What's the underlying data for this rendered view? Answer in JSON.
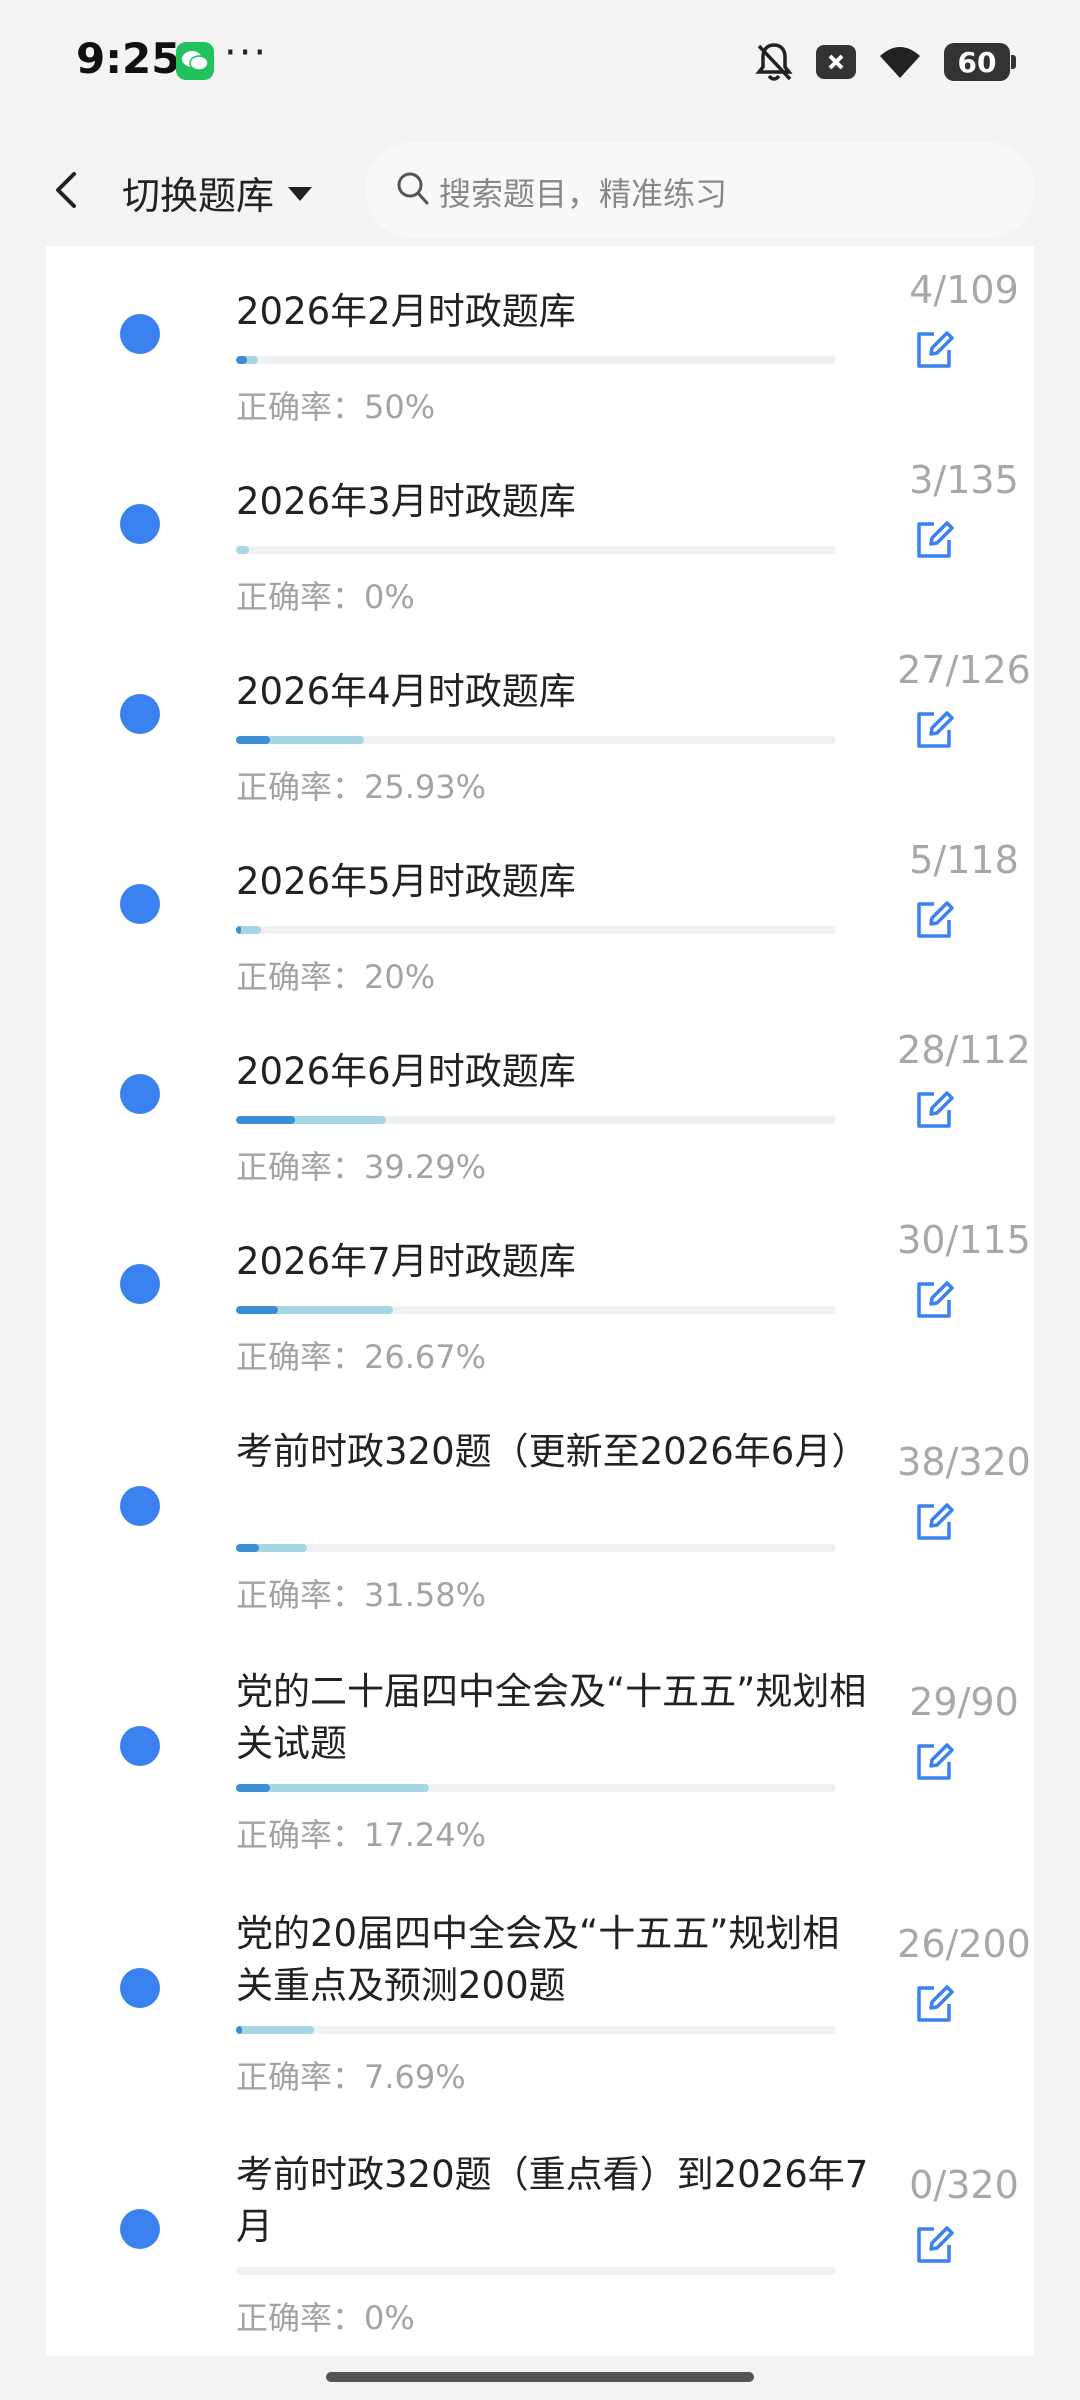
{
  "status_bar": {
    "time": "9:25",
    "battery": "60",
    "icons": [
      "wechat-icon",
      "more-dots-icon",
      "bell-off-icon",
      "close-box-icon",
      "wifi-icon",
      "battery-icon"
    ]
  },
  "header": {
    "switch_label": "切换题库",
    "search_placeholder": "搜索题目，精准练习"
  },
  "colors": {
    "accent_dot": "#3a82f0",
    "progress_primary": "#3a8fd4",
    "progress_secondary": "#a6d6e4",
    "edit_icon": "#3a82f0"
  },
  "items": [
    {
      "title": "2026年2月时政题库",
      "accuracy": "正确率：50%",
      "count": "4/109",
      "answered_fraction": 0.037,
      "correct_fraction": 0.018
    },
    {
      "title": "2026年3月时政题库",
      "accuracy": "正确率：0%",
      "count": "3/135",
      "answered_fraction": 0.022,
      "correct_fraction": 0.0
    },
    {
      "title": "2026年4月时政题库",
      "accuracy": "正确率：25.93%",
      "count": "27/126",
      "answered_fraction": 0.214,
      "correct_fraction": 0.056
    },
    {
      "title": "2026年5月时政题库",
      "accuracy": "正确率：20%",
      "count": "5/118",
      "answered_fraction": 0.042,
      "correct_fraction": 0.008
    },
    {
      "title": "2026年6月时政题库",
      "accuracy": "正确率：39.29%",
      "count": "28/112",
      "answered_fraction": 0.25,
      "correct_fraction": 0.098
    },
    {
      "title": "2026年7月时政题库",
      "accuracy": "正确率：26.67%",
      "count": "30/115",
      "answered_fraction": 0.261,
      "correct_fraction": 0.07
    },
    {
      "title": "考前时政320题（更新至2026年6月）",
      "accuracy": "正确率：31.58%",
      "count": "38/320",
      "answered_fraction": 0.119,
      "correct_fraction": 0.038
    },
    {
      "title": "党的二十届四中全会及“十五五”规划相关试题",
      "accuracy": "正确率：17.24%",
      "count": "29/90",
      "answered_fraction": 0.322,
      "correct_fraction": 0.056
    },
    {
      "title": "党的20届四中全会及“十五五”规划相关重点及预测200题",
      "accuracy": "正确率：7.69%",
      "count": "26/200",
      "answered_fraction": 0.13,
      "correct_fraction": 0.01
    },
    {
      "title": "考前时政320题（重点看）到2026年7月",
      "accuracy": "正确率：0%",
      "count": "0/320",
      "answered_fraction": 0.0,
      "correct_fraction": 0.0
    }
  ]
}
